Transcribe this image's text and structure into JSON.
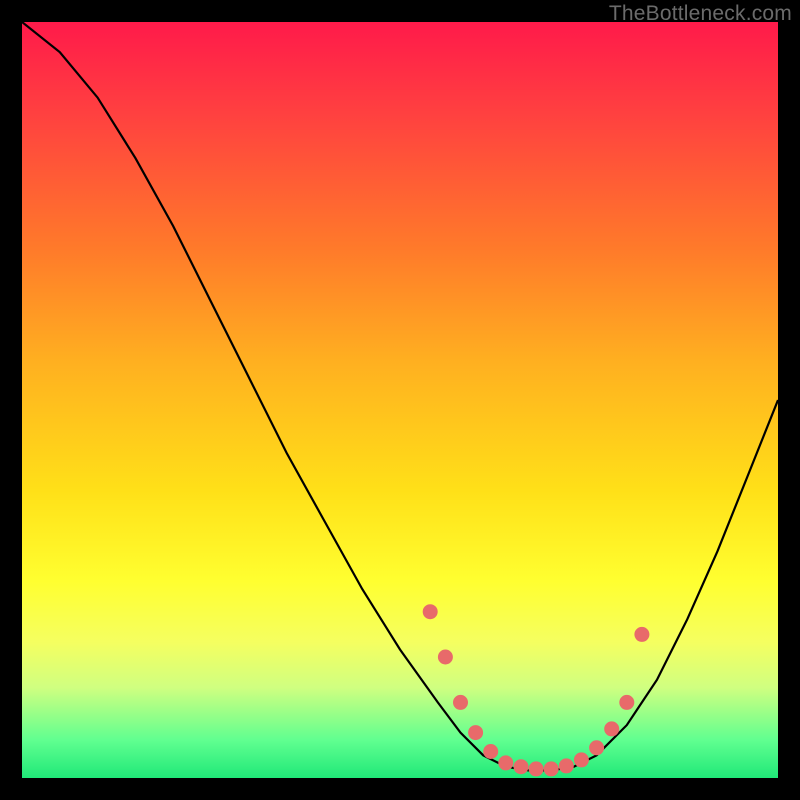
{
  "watermark": "TheBottleneck.com",
  "colors": {
    "curve_stroke": "#000000",
    "dot_fill": "#e86a6a",
    "dot_stroke": "#e86a6a"
  },
  "chart_data": {
    "type": "line",
    "title": "",
    "xlabel": "",
    "ylabel": "",
    "xlim": [
      0,
      100
    ],
    "ylim": [
      0,
      100
    ],
    "grid": false,
    "series": [
      {
        "name": "bottleneck-curve",
        "x": [
          0,
          5,
          10,
          15,
          20,
          25,
          30,
          35,
          40,
          45,
          50,
          55,
          58,
          61,
          64,
          67,
          70,
          73,
          76,
          80,
          84,
          88,
          92,
          96,
          100
        ],
        "y": [
          100,
          96,
          90,
          82,
          73,
          63,
          53,
          43,
          34,
          25,
          17,
          10,
          6,
          3,
          1.5,
          1,
          1,
          1.5,
          3,
          7,
          13,
          21,
          30,
          40,
          50
        ]
      }
    ],
    "dots": {
      "name": "highlighted-points",
      "x": [
        54,
        56,
        58,
        60,
        62,
        64,
        66,
        68,
        70,
        72,
        74,
        76,
        78,
        80,
        82
      ],
      "y": [
        22,
        16,
        10,
        6,
        3.5,
        2,
        1.5,
        1.2,
        1.2,
        1.6,
        2.4,
        4,
        6.5,
        10,
        19
      ]
    }
  }
}
